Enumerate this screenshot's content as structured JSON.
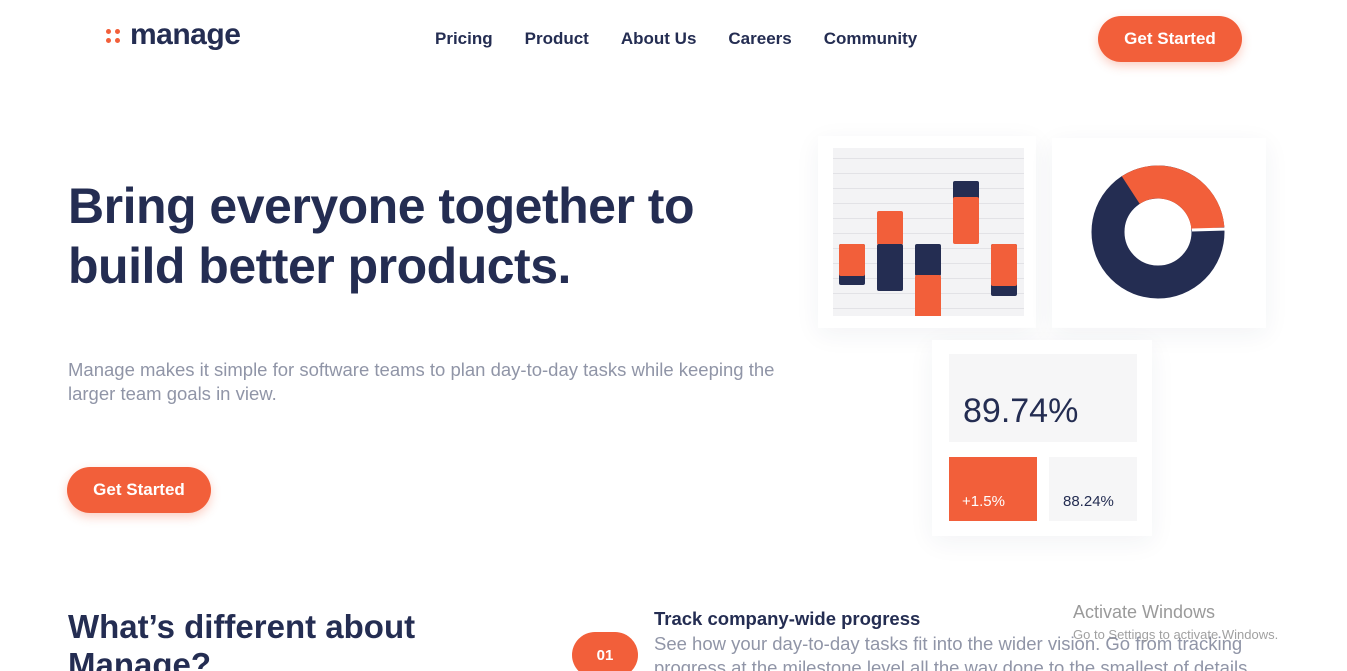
{
  "brand": {
    "name": "manage",
    "accent": "#f25f3a",
    "navy": "#242d52"
  },
  "nav": {
    "items": [
      {
        "label": "Pricing"
      },
      {
        "label": "Product"
      },
      {
        "label": "About Us"
      },
      {
        "label": "Careers"
      },
      {
        "label": "Community"
      }
    ],
    "cta_label": "Get Started"
  },
  "hero": {
    "title": "Bring everyone together to build better products.",
    "subtitle": "Manage makes it simple for software teams to plan day-to-day tasks while keeping the larger team goals in view.",
    "cta_label": "Get Started"
  },
  "illustration": {
    "donut": {
      "orange_fraction": 0.33,
      "navy_fraction": 0.67
    },
    "stats": {
      "main": "89.74%",
      "change": "+1.5%",
      "secondary": "88.24%"
    }
  },
  "features": {
    "heading": "What’s different about Manage?",
    "items": [
      {
        "number": "01",
        "title": "Track company-wide progress",
        "description": "See how your day-to-day tasks fit into the wider vision. Go from tracking progress at the milestone level all the way done to the smallest of details."
      }
    ]
  },
  "watermark": {
    "title": "Activate Windows",
    "subtitle": "Go to Settings to activate Windows."
  }
}
